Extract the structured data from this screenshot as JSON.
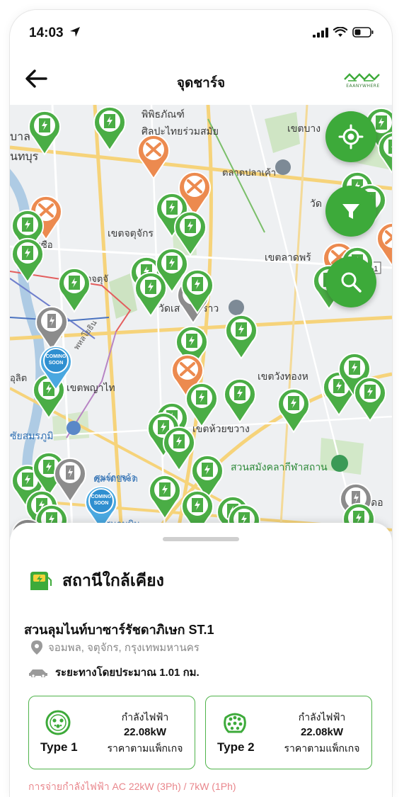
{
  "status_bar": {
    "time": "14:03"
  },
  "nav": {
    "title": "จุดชาร์จ",
    "brand": "EAANYWHERE"
  },
  "map": {
    "labels": [
      "พิพิธภัณฑ์",
      "ศิลปะไทยร่วมสมัย",
      "เขตบาง",
      "บาล",
      "นทบุร",
      "ตลาดปลาเค้า",
      "วัด",
      "เขตจตุจักร",
      "บางซื่อ",
      "เขตลาดพร้",
      "351",
      "วจตุจั",
      "วัดเส",
      "ราว",
      "พหลโยธิน",
      "เขตวังทองห",
      "อุลิต",
      "เขตพญาไท",
      "ซัยสมรภูมิ",
      "เขตห้วยขวาง",
      "ศูนย์การค้า",
      "ตลาดประต",
      "สนามบิน",
      "สวนสมังคลากีฬาสถาน",
      "ดอ"
    ],
    "coming_soon_badge": "COMING SOON",
    "pin_colors": {
      "ev": "#4aad45",
      "service": "#ec8a4f",
      "unavailable": "#8c8c8c",
      "coming": "#4aa8e0"
    },
    "fab_buttons": [
      "locate-icon",
      "filter-icon",
      "search-icon"
    ]
  },
  "sheet": {
    "title": "สถานีใกล้เคียง",
    "station": {
      "name": "สวนลุมไนท์บาซาร์รัชดาภิเษก ST.1",
      "address": "จอมพล, จตุจักร, กรุงเทพมหานคร",
      "distance": "ระยะทางโดยประมาณ 1.01 กม."
    },
    "connectors": [
      {
        "type": "Type 1",
        "power_label": "กำลังไฟฟ้า",
        "power": "22.08kW",
        "price": "ราคาตามแพ็กเกจ"
      },
      {
        "type": "Type 2",
        "power_label": "กำลังไฟฟ้า",
        "power": "22.08kW",
        "price": "ราคาตามแพ็กเกจ"
      }
    ],
    "ac_note": "การจ่ายกำลังไฟฟ้า AC 22kW (3Ph) / 7kW (1Ph)"
  }
}
